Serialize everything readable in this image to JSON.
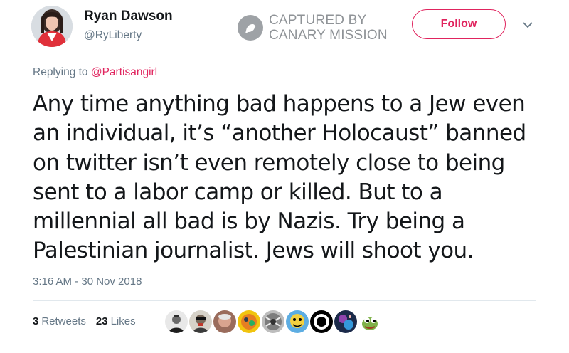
{
  "user": {
    "display_name": "Ryan Dawson",
    "handle": "@RyLiberty",
    "avatar_icon": "profile-photo-avatar"
  },
  "stamp": {
    "line1": "CAPTURED BY",
    "line2": "CANARY MISSION",
    "icon": "canary-bird-icon"
  },
  "follow_label": "Follow",
  "caret_icon": "chevron-down-icon",
  "reply": {
    "prefix": "Replying to",
    "to": "@Partisangirl"
  },
  "tweet": {
    "lines": [
      "Any time anything bad happens to a Jew even",
      "an individual, it’s “another Holocaust” banned",
      "on twitter isn’t even remotely close to being",
      "sent to a labor camp or killed. But to a",
      "millennial all bad is by Nazis. Try being a",
      "Palestinian journalist. Jews will shoot you."
    ]
  },
  "timestamp": "3:16 AM - 30 Nov 2018",
  "stats": {
    "retweets_count": "3",
    "retweets_label": "Retweets",
    "likes_count": "23",
    "likes_label": "Likes"
  },
  "colors": {
    "accent": "#e0245e",
    "secondary_text": "#657786",
    "primary_text": "#14171a",
    "divider": "#e1e8ed"
  }
}
